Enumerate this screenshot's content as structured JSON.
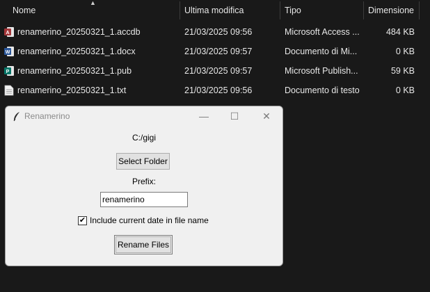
{
  "explorer": {
    "columns": {
      "name": "Nome",
      "modified": "Ultima modifica",
      "type": "Tipo",
      "size": "Dimensione"
    },
    "files": [
      {
        "icon": "access-file-icon",
        "name": "renamerino_20250321_1.accdb",
        "modified": "21/03/2025 09:56",
        "type": "Microsoft Access ...",
        "size": "484 KB"
      },
      {
        "icon": "word-file-icon",
        "name": "renamerino_20250321_1.docx",
        "modified": "21/03/2025 09:57",
        "type": "Documento di Mi...",
        "size": "0 KB"
      },
      {
        "icon": "publisher-file-icon",
        "name": "renamerino_20250321_1.pub",
        "modified": "21/03/2025 09:57",
        "type": "Microsoft Publish...",
        "size": "59 KB"
      },
      {
        "icon": "text-file-icon",
        "name": "renamerino_20250321_1.txt",
        "modified": "21/03/2025 09:56",
        "type": "Documento di testo",
        "size": "0 KB"
      }
    ]
  },
  "app": {
    "title": "Renamerino",
    "folder_path": "C:/gigi",
    "select_folder_label": "Select Folder",
    "prefix_label": "Prefix:",
    "prefix_value": "renamerino",
    "include_date_label": "Include current date in file name",
    "include_date_checked": true,
    "checkmark": "✔",
    "rename_label": "Rename Files",
    "minimize_glyph": "—",
    "maximize_glyph": "☐",
    "close_glyph": "✕"
  },
  "colors": {
    "explorer_bg": "#191919",
    "window_bg": "#f0f0f0",
    "access": "#a4373a",
    "word": "#2b579a",
    "publisher": "#077568"
  }
}
